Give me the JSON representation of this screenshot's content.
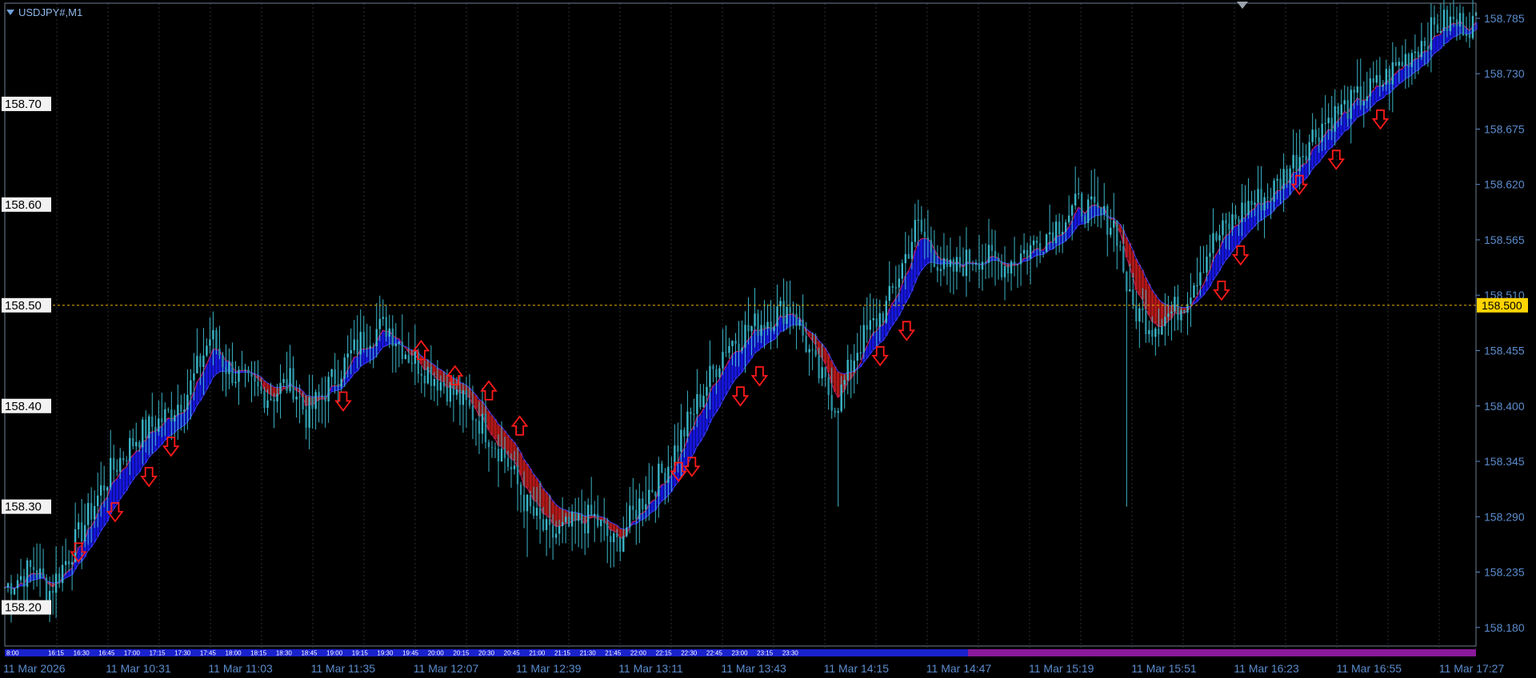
{
  "window": {
    "symbol": "USDJPY#,M1"
  },
  "colors": {
    "background": "#000000",
    "frame": "#6e8090",
    "grid": "#2a2f36",
    "candle": "#3bb6c8",
    "band_up": "#1515d8",
    "band_down": "#b01818",
    "line_edge": "#c01c5c",
    "arrow": "#ff1a1a",
    "price_line": "#d8a000",
    "price_tag": "#ffd400",
    "axis_text": "#5b8ccc",
    "left_label_bg": "#f2f2f2",
    "session_blue": "#1a22cc",
    "session_magenta": "#8a1a9a"
  },
  "current_price_label": "158.500",
  "chart_data": {
    "type": "candlestick",
    "timeframe": "M1",
    "y_range": [
      158.16,
      158.8
    ],
    "right_axis_ticks": [
      "158.785",
      "158.730",
      "158.675",
      "158.620",
      "158.565",
      "158.510",
      "158.455",
      "158.400",
      "158.345",
      "158.290",
      "158.235",
      "158.180"
    ],
    "left_axis_ticks": [
      "158.70",
      "158.60",
      "158.50",
      "158.40",
      "158.30",
      "158.20"
    ],
    "x_axis_labels": [
      "11 Mar 2026",
      "11 Mar 10:31",
      "11 Mar 11:03",
      "11 Mar 11:35",
      "11 Mar 12:07",
      "11 Mar 12:39",
      "11 Mar 13:11",
      "11 Mar 13:43",
      "11 Mar 14:15",
      "11 Mar 14:47",
      "11 Mar 15:19",
      "11 Mar 15:51",
      "11 Mar 16:23",
      "11 Mar 16:55",
      "11 Mar 17:27"
    ],
    "session_labels": [
      "8:00",
      "16:15",
      "16:30",
      "16:45",
      "17:00",
      "17:15",
      "17:30",
      "17:45",
      "18:00",
      "18:15",
      "18:30",
      "18:45",
      "19:00",
      "19:15",
      "19:30",
      "19:45",
      "20:00",
      "20:15",
      "20:30",
      "20:45",
      "21:00",
      "21:15",
      "21:30",
      "21:45",
      "22:00",
      "22:15",
      "22:30",
      "22:45",
      "23:00",
      "23:15",
      "23:30"
    ],
    "price_level": 158.5,
    "price_path": [
      [
        0,
        158.22
      ],
      [
        0.02,
        158.24
      ],
      [
        0.03,
        158.215
      ],
      [
        0.05,
        158.27
      ],
      [
        0.07,
        158.33
      ],
      [
        0.09,
        158.37
      ],
      [
        0.11,
        158.39
      ],
      [
        0.125,
        158.415
      ],
      [
        0.14,
        158.47
      ],
      [
        0.15,
        158.44
      ],
      [
        0.165,
        158.42
      ],
      [
        0.18,
        158.41
      ],
      [
        0.195,
        158.425
      ],
      [
        0.205,
        158.39
      ],
      [
        0.215,
        158.41
      ],
      [
        0.225,
        158.43
      ],
      [
        0.245,
        158.47
      ],
      [
        0.26,
        158.48
      ],
      [
        0.275,
        158.45
      ],
      [
        0.3,
        158.42
      ],
      [
        0.32,
        158.39
      ],
      [
        0.34,
        158.35
      ],
      [
        0.355,
        158.3
      ],
      [
        0.37,
        158.27
      ],
      [
        0.385,
        158.28
      ],
      [
        0.4,
        158.29
      ],
      [
        0.415,
        158.26
      ],
      [
        0.43,
        158.3
      ],
      [
        0.45,
        158.34
      ],
      [
        0.47,
        158.4
      ],
      [
        0.49,
        158.46
      ],
      [
        0.51,
        158.48
      ],
      [
        0.535,
        158.5
      ],
      [
        0.55,
        158.44
      ],
      [
        0.565,
        158.4
      ],
      [
        0.58,
        158.46
      ],
      [
        0.6,
        158.5
      ],
      [
        0.62,
        158.58
      ],
      [
        0.64,
        158.53
      ],
      [
        0.66,
        158.55
      ],
      [
        0.68,
        158.54
      ],
      [
        0.7,
        158.56
      ],
      [
        0.73,
        158.6
      ],
      [
        0.755,
        158.58
      ],
      [
        0.765,
        158.5
      ],
      [
        0.78,
        158.48
      ],
      [
        0.8,
        158.5
      ],
      [
        0.82,
        158.56
      ],
      [
        0.845,
        158.6
      ],
      [
        0.86,
        158.61
      ],
      [
        0.875,
        158.64
      ],
      [
        0.895,
        158.68
      ],
      [
        0.915,
        158.7
      ],
      [
        0.935,
        158.72
      ],
      [
        0.955,
        158.75
      ],
      [
        0.975,
        158.78
      ],
      [
        1.0,
        158.78
      ]
    ],
    "spikes": [
      [
        0.762,
        158.3
      ],
      [
        0.567,
        158.3
      ],
      [
        0.355,
        158.25
      ],
      [
        0.415,
        158.24
      ]
    ],
    "up_arrows": [
      [
        0.05,
        158.255
      ],
      [
        0.075,
        158.295
      ],
      [
        0.098,
        158.33
      ],
      [
        0.113,
        158.36
      ],
      [
        0.23,
        158.405
      ],
      [
        0.458,
        158.335
      ],
      [
        0.467,
        158.34
      ],
      [
        0.5,
        158.41
      ],
      [
        0.513,
        158.43
      ],
      [
        0.595,
        158.45
      ],
      [
        0.613,
        158.475
      ],
      [
        0.827,
        158.515
      ],
      [
        0.84,
        158.55
      ],
      [
        0.88,
        158.62
      ],
      [
        0.905,
        158.645
      ],
      [
        0.935,
        158.685
      ]
    ],
    "down_arrows": [
      [
        0.283,
        158.455
      ],
      [
        0.306,
        158.43
      ],
      [
        0.329,
        158.415
      ],
      [
        0.35,
        158.38
      ]
    ]
  }
}
